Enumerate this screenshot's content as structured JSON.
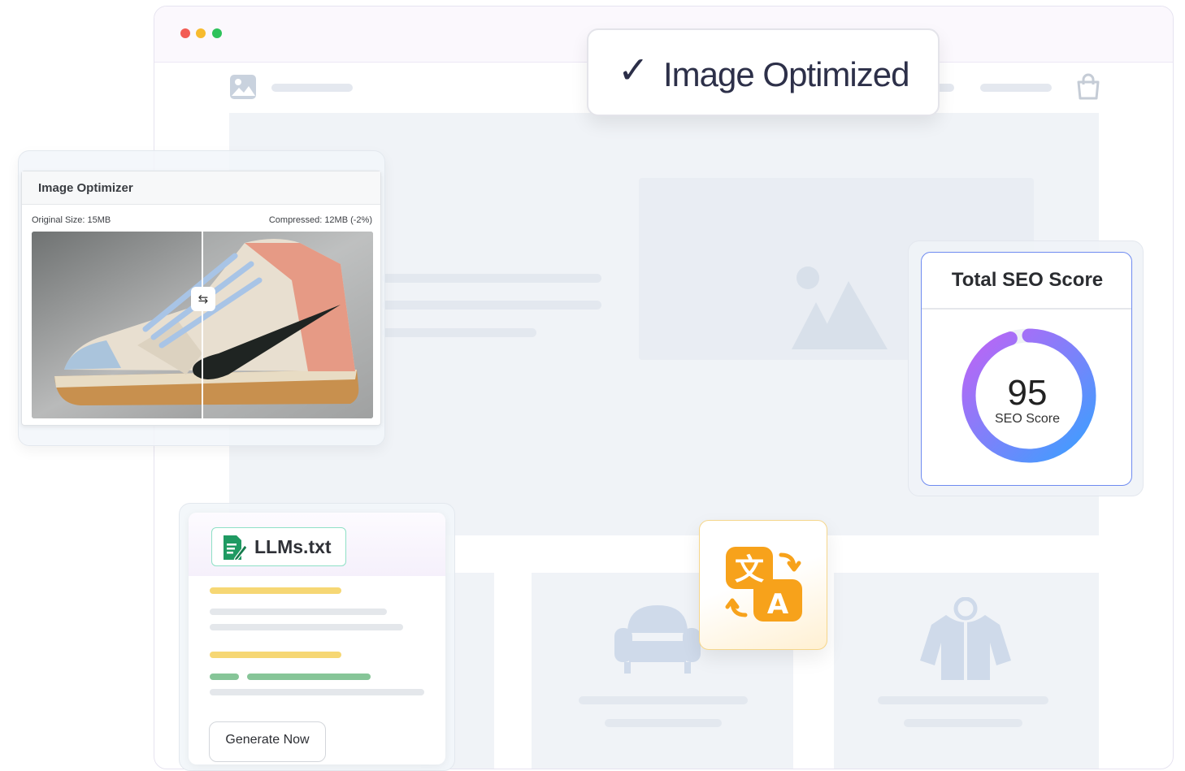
{
  "browser": {
    "window_controls": [
      "close-dot",
      "minimize-dot",
      "maximize-dot"
    ],
    "colors": {
      "close": "#f25c54",
      "minimize": "#f7bb2e",
      "maximize": "#2ec25b"
    }
  },
  "optimized_badge": {
    "check_glyph": "✓",
    "label": "Image Optimized"
  },
  "image_optimizer": {
    "title": "Image Optimizer",
    "original_size": "Original Size: 15MB",
    "compressed": "Compressed: 12MB (-2%)",
    "compare_handle_glyph": "⇆"
  },
  "seo": {
    "title": "Total SEO Score",
    "score": "95",
    "score_label": "SEO Score",
    "score_fraction": 0.95,
    "gradient": [
      "#3aa0ff",
      "#c063f5"
    ]
  },
  "llms": {
    "badge_label": "LLMs.txt",
    "button_label": "Generate Now"
  },
  "translate": {
    "glyph_source": "文",
    "glyph_target": "A",
    "accent": "#f7a21b"
  },
  "icons": [
    "image-icon",
    "cart-icon",
    "mountain-image-icon",
    "armchair-icon",
    "jacket-icon",
    "document-edit-icon",
    "translate-icon"
  ]
}
